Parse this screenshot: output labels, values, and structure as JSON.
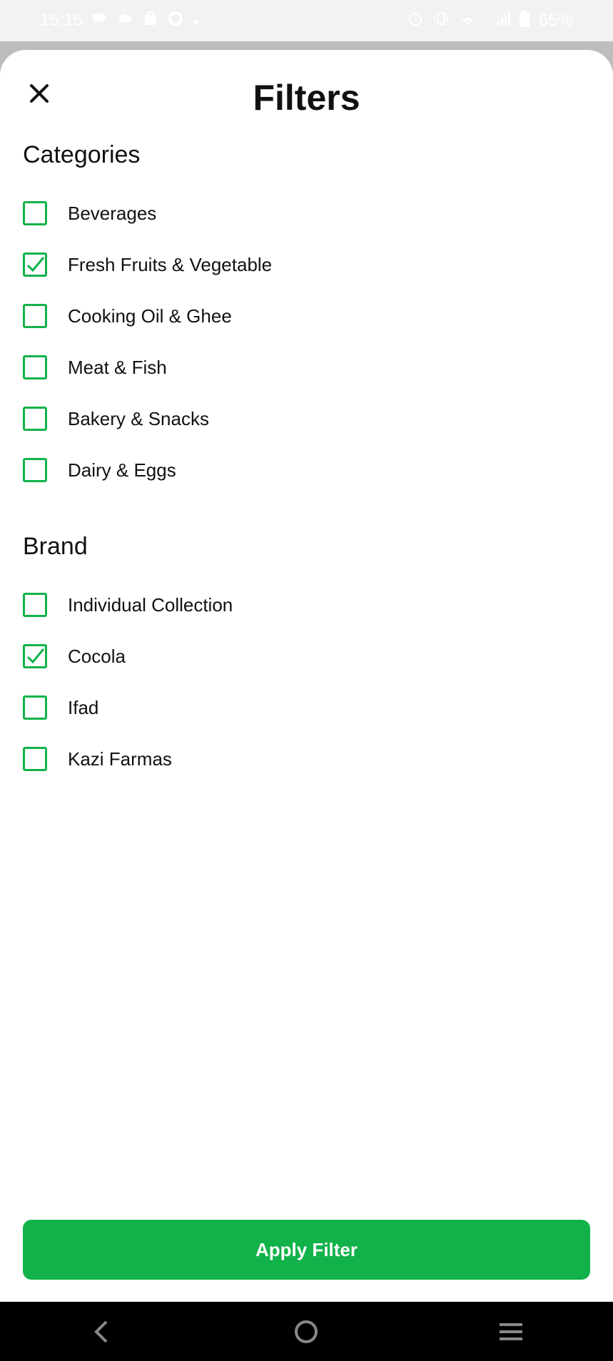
{
  "status_bar": {
    "time": "15:15",
    "battery": "65%",
    "left_icons": [
      "chat-icon",
      "cloud-icon",
      "bag-icon",
      "sync-icon",
      "dot-icon"
    ],
    "right_icons": [
      "alarm-icon",
      "vibrate-icon",
      "hotspot-icon",
      "signal-4g-icon",
      "battery-icon"
    ]
  },
  "header": {
    "title": "Filters",
    "close_icon": "close-icon"
  },
  "categories": {
    "title": "Categories",
    "items": [
      {
        "label": "Beverages",
        "checked": false
      },
      {
        "label": "Fresh Fruits & Vegetable",
        "checked": true
      },
      {
        "label": "Cooking Oil & Ghee",
        "checked": false
      },
      {
        "label": "Meat & Fish",
        "checked": false
      },
      {
        "label": "Bakery & Snacks",
        "checked": false
      },
      {
        "label": "Dairy & Eggs",
        "checked": false
      }
    ]
  },
  "brand": {
    "title": "Brand",
    "items": [
      {
        "label": "Individual Collection",
        "checked": false
      },
      {
        "label": "Cocola",
        "checked": true
      },
      {
        "label": "Ifad",
        "checked": false
      },
      {
        "label": "Kazi Farmas",
        "checked": false
      }
    ]
  },
  "apply_button": {
    "label": "Apply Filter"
  },
  "colors": {
    "accent": "#12b24a",
    "text": "#111111"
  },
  "nav_bar": {
    "icons": [
      "back-icon",
      "home-icon",
      "recents-icon"
    ]
  }
}
